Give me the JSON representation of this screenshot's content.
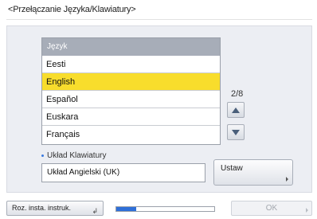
{
  "title": "<Przełączanie Języka/Klawiatury>",
  "language_list": {
    "header": "Język",
    "items": [
      "Eesti",
      "English",
      "Español",
      "Euskara",
      "Français"
    ],
    "selected_index": 1
  },
  "pager": {
    "indicator": "2/8",
    "up_icon": "triangle-up-icon",
    "down_icon": "triangle-down-icon"
  },
  "keyboard": {
    "label": "Układ Klawiatury",
    "value": "Układ Angielski (UK)"
  },
  "set_button": {
    "label": "Ustaw"
  },
  "footer": {
    "reset_label": "Roz. insta. instruk.",
    "reset_icon": "enter-icon",
    "progress_fraction": 0.2,
    "ok_label": "OK"
  },
  "colors": {
    "selected": "#f8dd2c",
    "header": "#a7adb8",
    "accent": "#2f6fd8"
  }
}
